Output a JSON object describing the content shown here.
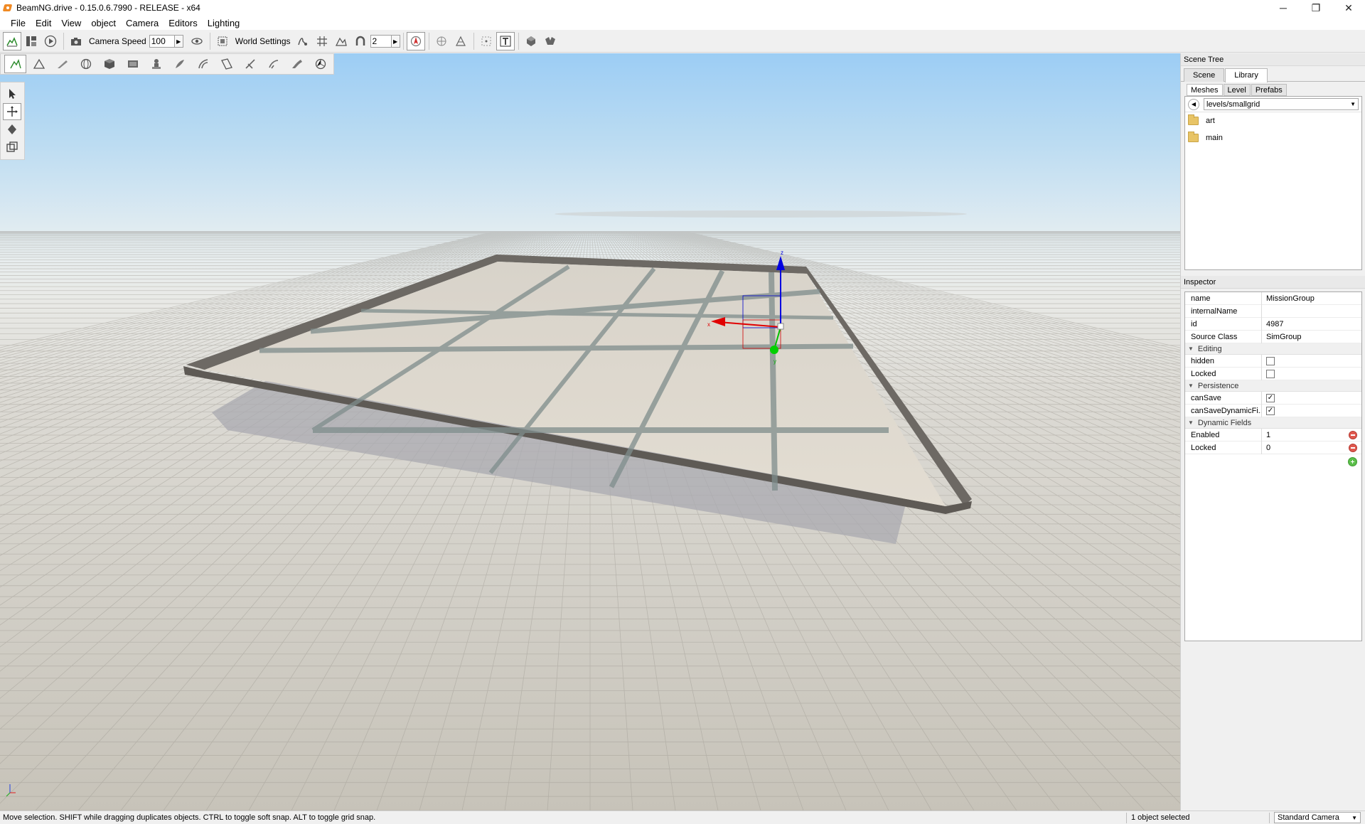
{
  "window": {
    "title": "BeamNG.drive - 0.15.0.6.7990 - RELEASE - x64",
    "controls": [
      "─",
      "❐",
      "✕"
    ]
  },
  "menu": [
    "File",
    "Edit",
    "View",
    "object",
    "Camera",
    "Editors",
    "Lighting"
  ],
  "toolbar": {
    "camera_speed_label": "Camera Speed",
    "camera_speed_value": "100",
    "world_settings_label": "World Settings",
    "grid_value": "2"
  },
  "viewport": {
    "gizmo_labels": {
      "z": "z",
      "x": "x",
      "y": "y"
    }
  },
  "status": {
    "hint": "Move selection.  SHIFT while dragging duplicates objects.  CTRL to toggle soft snap.  ALT to toggle grid snap.",
    "selected": "1 object selected",
    "camera_mode": "Standard Camera"
  },
  "scene_tree": {
    "title": "Scene Tree",
    "tabs": [
      "Scene",
      "Library"
    ],
    "subtabs": [
      "Meshes",
      "Level",
      "Prefabs"
    ],
    "path": "levels/smallgrid",
    "folders": [
      "art",
      "main"
    ]
  },
  "inspector": {
    "title": "Inspector",
    "fields": [
      {
        "key": "name",
        "value": "MissionGroup"
      },
      {
        "key": "internalName",
        "value": ""
      },
      {
        "key": "id",
        "value": "4987"
      },
      {
        "key": "Source Class",
        "value": "SimGroup"
      }
    ],
    "editing": {
      "title": "Editing",
      "rows": [
        {
          "key": "hidden",
          "checked": false
        },
        {
          "key": "Locked",
          "checked": false
        }
      ]
    },
    "persistence": {
      "title": "Persistence",
      "rows": [
        {
          "key": "canSave",
          "checked": true
        },
        {
          "key": "canSaveDynamicFi...",
          "checked": true
        }
      ]
    },
    "dynamic_fields": {
      "title": "Dynamic Fields",
      "rows": [
        {
          "key": "Enabled",
          "value": "1"
        },
        {
          "key": "Locked",
          "value": "0"
        }
      ]
    }
  },
  "colors": {
    "sky_top": "#a9d3f5",
    "horizon": "#e9ebea",
    "ground": "#cfcbc0",
    "platform": "#ddd7cc",
    "platform_border": "#6e6a65",
    "gizmo_x": "#e00000",
    "gizmo_y": "#00c000",
    "gizmo_z": "#0000e0"
  }
}
